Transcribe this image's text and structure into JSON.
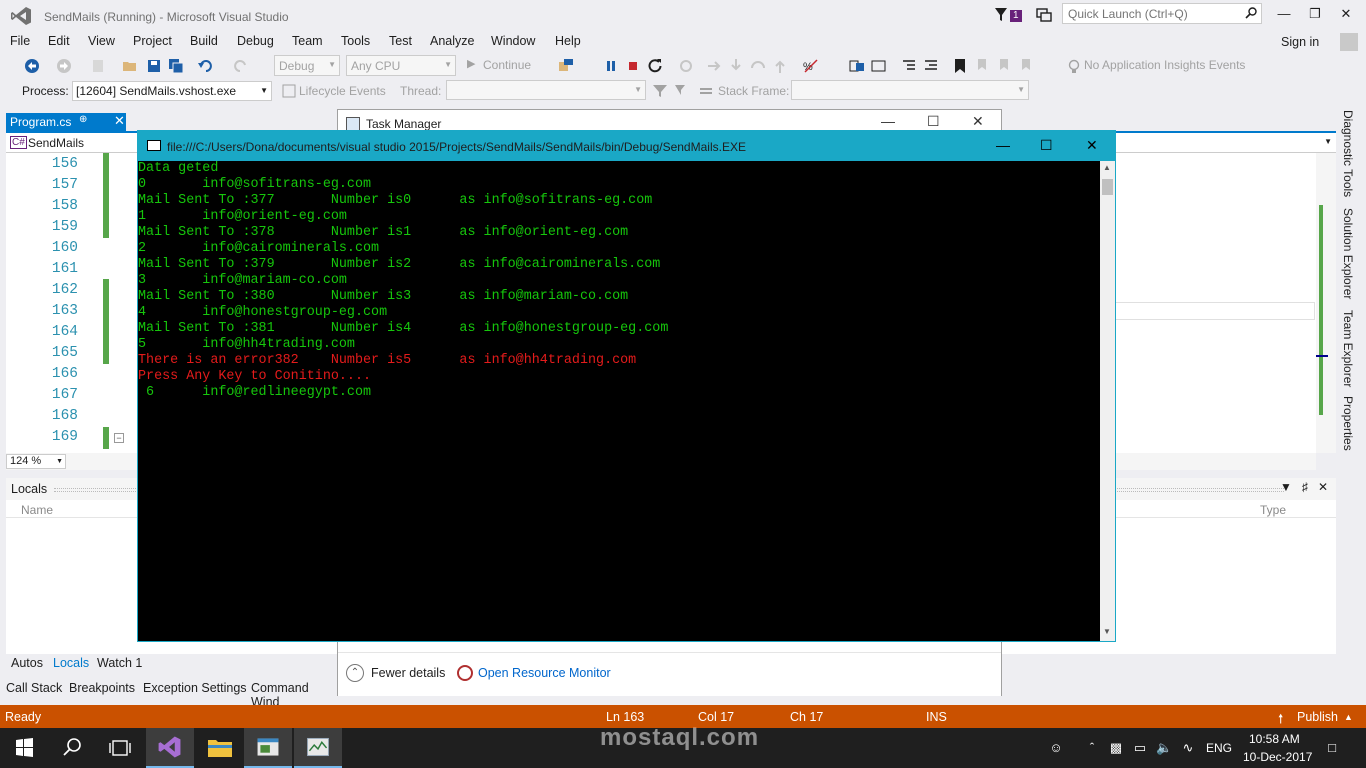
{
  "window": {
    "title": "SendMails (Running) - Microsoft Visual Studio",
    "notification_count": "1",
    "quick_launch_placeholder": "Quick Launch (Ctrl+Q)",
    "sign_in": "Sign in"
  },
  "menu": [
    "File",
    "Edit",
    "View",
    "Project",
    "Build",
    "Debug",
    "Team",
    "Tools",
    "Test",
    "Analyze",
    "Window",
    "Help"
  ],
  "toolbar": {
    "config": "Debug",
    "platform": "Any CPU",
    "continue": "Continue",
    "insights": "No Application Insights Events",
    "process_label": "Process:",
    "process_value": "[12604] SendMails.vshost.exe",
    "lifecycle": "Lifecycle Events",
    "thread_label": "Thread:",
    "stack_frame_label": "Stack Frame:"
  },
  "editor": {
    "tab": "Program.cs",
    "nav_project": "SendMails",
    "line_numbers": [
      "156",
      "157",
      "158",
      "159",
      "160",
      "161",
      "162",
      "163",
      "164",
      "165",
      "166",
      "167",
      "168",
      "169"
    ],
    "zoom": "124 %"
  },
  "side_tabs": [
    "Diagnostic Tools",
    "Solution Explorer",
    "Team Explorer",
    "Properties"
  ],
  "locals": {
    "title": "Locals",
    "col_name": "Name",
    "col_type": "Type"
  },
  "bottom_tabs": [
    "Autos",
    "Locals",
    "Watch 1"
  ],
  "bottom_tabs2": [
    "Call Stack",
    "Breakpoints",
    "Exception Settings",
    "Command Wind"
  ],
  "status": {
    "ready": "Ready",
    "ln": "Ln 163",
    "col": "Col 17",
    "ch": "Ch 17",
    "ins": "INS",
    "publish": "Publish"
  },
  "task_manager": {
    "title": "Task Manager",
    "fewer_details": "Fewer details",
    "open_resource_monitor": "Open Resource Monitor"
  },
  "console": {
    "title": "file:///C:/Users/Dona/documents/visual studio 2015/Projects/SendMails/SendMails/bin/Debug/SendMails.EXE",
    "lines": [
      {
        "text": "Data geted",
        "color": "#16c60c"
      },
      {
        "text": "0       info@sofitrans-eg.com",
        "color": "#16c60c"
      },
      {
        "text": "Mail Sent To :377       Number is0      as info@sofitrans-eg.com",
        "color": "#16c60c"
      },
      {
        "text": "1       info@orient-eg.com",
        "color": "#16c60c"
      },
      {
        "text": "Mail Sent To :378       Number is1      as info@orient-eg.com",
        "color": "#16c60c"
      },
      {
        "text": "2       info@cairominerals.com",
        "color": "#16c60c"
      },
      {
        "text": "Mail Sent To :379       Number is2      as info@cairominerals.com",
        "color": "#16c60c"
      },
      {
        "text": "3       info@mariam-co.com",
        "color": "#16c60c"
      },
      {
        "text": "Mail Sent To :380       Number is3      as info@mariam-co.com",
        "color": "#16c60c"
      },
      {
        "text": "4       info@honestgroup-eg.com",
        "color": "#16c60c"
      },
      {
        "text": "Mail Sent To :381       Number is4      as info@honestgroup-eg.com",
        "color": "#16c60c"
      },
      {
        "text": "5       info@hh4trading.com",
        "color": "#16c60c"
      },
      {
        "text": "There is an error382    Number is5      as info@hh4trading.com",
        "color": "#e31b1b"
      },
      {
        "text": "Press Any Key to Conitino....",
        "color": "#e31b1b"
      },
      {
        "text": " 6      info@redlineegypt.com",
        "color": "#16c60c"
      }
    ]
  },
  "taskbar": {
    "lang": "ENG",
    "time": "10:58 AM",
    "date": "10-Dec-2017"
  },
  "watermark": "mostaql.com"
}
